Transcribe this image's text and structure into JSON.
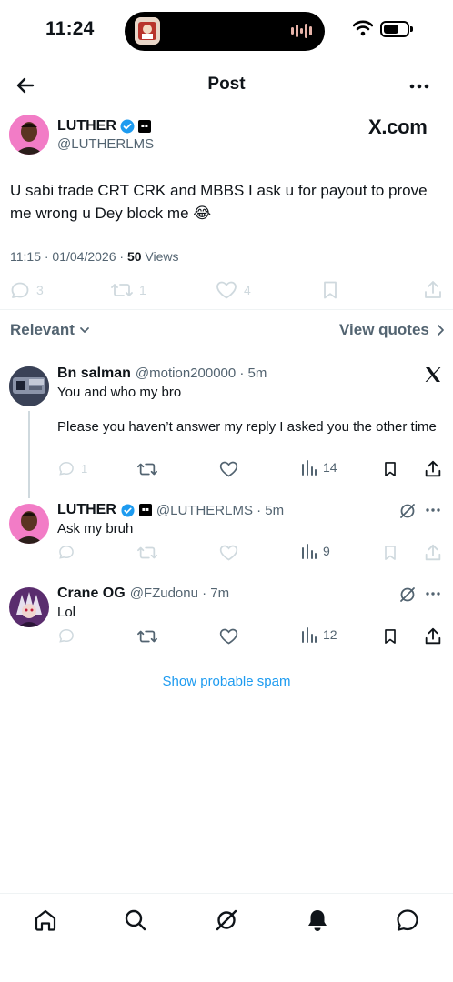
{
  "status_bar": {
    "time": "11:24"
  },
  "header": {
    "title": "Post"
  },
  "post": {
    "author": {
      "name": "LUTHER",
      "handle": "@LUTHERLMS"
    },
    "source_brand": "X.com",
    "text": "U sabi trade CRT  CRK and MBBS I ask u for payout to prove me wrong u Dey block me 😂",
    "timestamp": "11:15 · 01/04/2026 · ",
    "views_count": "50",
    "views_label": " Views",
    "actions": {
      "replies": "3",
      "reposts": "1",
      "likes": "4"
    }
  },
  "sort": {
    "label": "Relevant",
    "quotes_label": "View quotes"
  },
  "replies": [
    {
      "name": "Bn salman",
      "handle": "@motion200000 · 5m",
      "text_line1": "You and who my bro",
      "text_line2": "Please you haven’t answer my reply I asked you the other time",
      "replies": "1",
      "views": "14"
    },
    {
      "name": "LUTHER",
      "handle": "@LUTHERLMS · 5m",
      "text": "Ask my bruh",
      "views": "9"
    },
    {
      "name": "Crane OG",
      "handle": "@FZudonu · 7m",
      "text": "Lol",
      "views": "12"
    }
  ],
  "spam_link": "Show probable spam",
  "icons": {
    "header": [
      "back-arrow-icon",
      "more-icon"
    ],
    "tab_bar": [
      "home-icon",
      "search-icon",
      "grok-icon",
      "notifications-icon",
      "messages-icon"
    ]
  },
  "colors": {
    "accent": "#1d9bf0",
    "text": "#0f1419",
    "secondary": "#536471",
    "border": "#eff3f4"
  }
}
